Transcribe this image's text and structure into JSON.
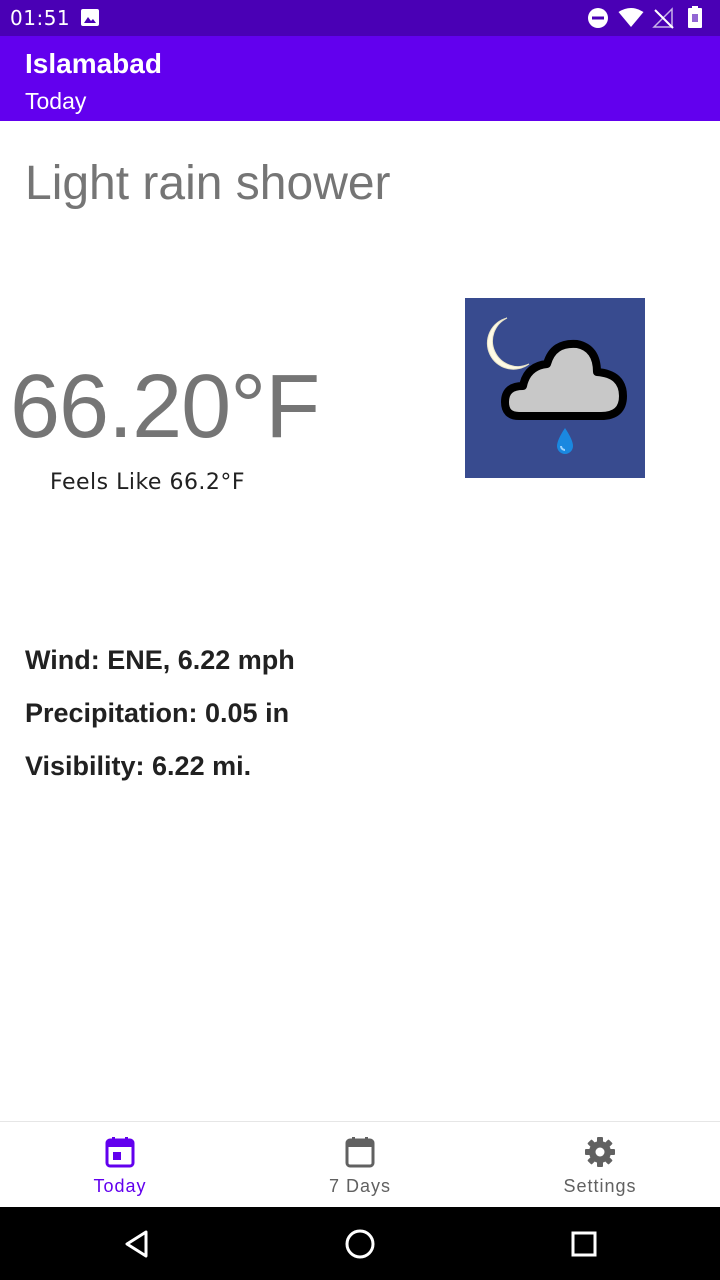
{
  "status_bar": {
    "time": "01:51",
    "icons": [
      "image-icon",
      "do-not-disturb-icon",
      "wifi-icon",
      "no-signal-icon",
      "battery-icon"
    ]
  },
  "app_bar": {
    "title": "Islamabad",
    "subtitle": "Today"
  },
  "weather": {
    "condition": "Light rain shower",
    "temperature": "66.20°F",
    "feels_like": "Feels Like 66.2°F",
    "icon": "night-rain-shower-icon",
    "wind": "Wind: ENE, 6.22 mph",
    "precipitation": "Precipitation: 0.05 in",
    "visibility": "Visibility: 6.22 mi."
  },
  "bottom_nav": {
    "items": [
      {
        "label": "Today",
        "icon": "calendar-today-icon",
        "active": true
      },
      {
        "label": "7 Days",
        "icon": "calendar-icon",
        "active": false
      },
      {
        "label": "Settings",
        "icon": "gear-icon",
        "active": false
      }
    ]
  },
  "colors": {
    "status_bar": "#4a00b5",
    "app_bar": "#6200ee",
    "accent": "#6200ee",
    "icon_background": "#384b8f"
  }
}
